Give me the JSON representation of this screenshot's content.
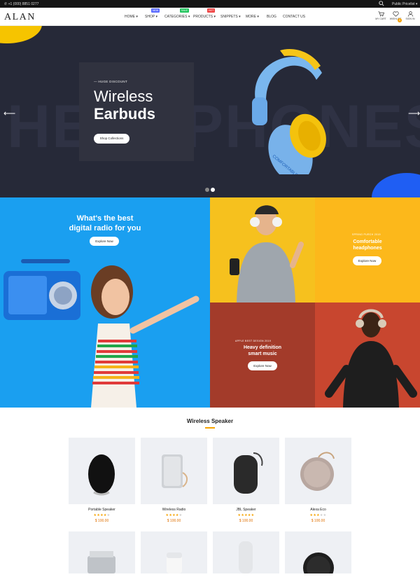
{
  "topbar": {
    "phone": "+1 (000) 8851 0277",
    "price_list": "Public Pricelist"
  },
  "header": {
    "logo": "ALAN",
    "nav": [
      {
        "label": "HOME"
      },
      {
        "label": "SHOP",
        "badge": "NEW",
        "badge_color": "#5b6bff"
      },
      {
        "label": "CATEGORIES",
        "badge": "SALE",
        "badge_color": "#22c55e"
      },
      {
        "label": "PRODUCTS",
        "badge": "HOT",
        "badge_color": "#ef4444"
      },
      {
        "label": "SNIPPETS"
      },
      {
        "label": "MORE"
      },
      {
        "label": "BLOG"
      },
      {
        "label": "CONTACT US"
      }
    ],
    "icons": [
      {
        "icon": "cart-icon",
        "label": "MY CART"
      },
      {
        "icon": "heart-icon",
        "label": "WISHLIST",
        "count": "0"
      },
      {
        "icon": "user-icon",
        "label": "SIGN IN"
      }
    ]
  },
  "hero": {
    "kicker": "— HUGE DISCOUNT",
    "line1": "Wireless",
    "line2": "Earbuds",
    "button": "Shop Collections",
    "bg_text": "HEADPHONES",
    "product_text": "COMFORTABLE"
  },
  "promo_left": {
    "title_line1": "What's the best",
    "title_line2": "digital radio for you",
    "button": "Explore Now"
  },
  "promo_top_right": {
    "kicker": "SPRING PURCH 2019",
    "title_line1": "Comfortable",
    "title_line2": "headphones",
    "button": "Explore Now"
  },
  "promo_bottom_right": {
    "kicker": "APPLE BEST DESIGN 2019",
    "title_line1": "Heavy definition",
    "title_line2": "smart music",
    "button": "Explore Now"
  },
  "section": {
    "title": "Wireless Speaker"
  },
  "products": [
    {
      "name": "Portable Speaker",
      "rating": 4,
      "price": "$ 100.00"
    },
    {
      "name": "Wireless Radio",
      "rating": 4,
      "price": "$ 100.00"
    },
    {
      "name": "JBL Speaker",
      "rating": 5,
      "price": "$ 100.00"
    },
    {
      "name": "Alexa Eco",
      "rating": 3,
      "price": "$ 100.00"
    }
  ]
}
